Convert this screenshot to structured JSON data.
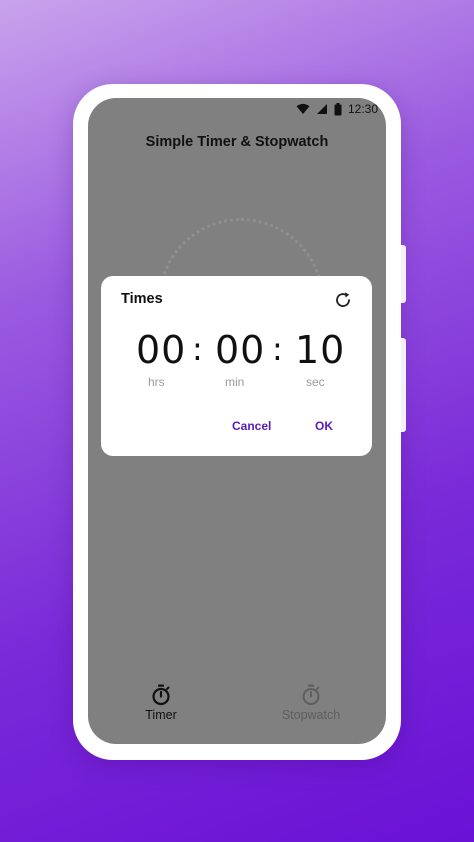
{
  "status_bar": {
    "time": "12:30",
    "icons": [
      "wifi-icon",
      "signal-icon",
      "battery-icon"
    ]
  },
  "app": {
    "title": "Simple Timer & Stopwatch"
  },
  "dialog": {
    "title": "Times",
    "hours": "00",
    "minutes": "00",
    "seconds": "10",
    "separator": ":",
    "hours_unit": "hrs",
    "minutes_unit": "min",
    "seconds_unit": "sec",
    "cancel_label": "Cancel",
    "ok_label": "OK"
  },
  "nav": {
    "items": [
      {
        "label": "Timer",
        "icon": "stopwatch-icon",
        "active": true
      },
      {
        "label": "Stopwatch",
        "icon": "stopwatch-icon",
        "active": false
      }
    ]
  },
  "colors": {
    "accent": "#5b19b8",
    "scrim": "#808080",
    "background_top": "#c9a3ec",
    "background_bottom": "#6a12d6"
  }
}
